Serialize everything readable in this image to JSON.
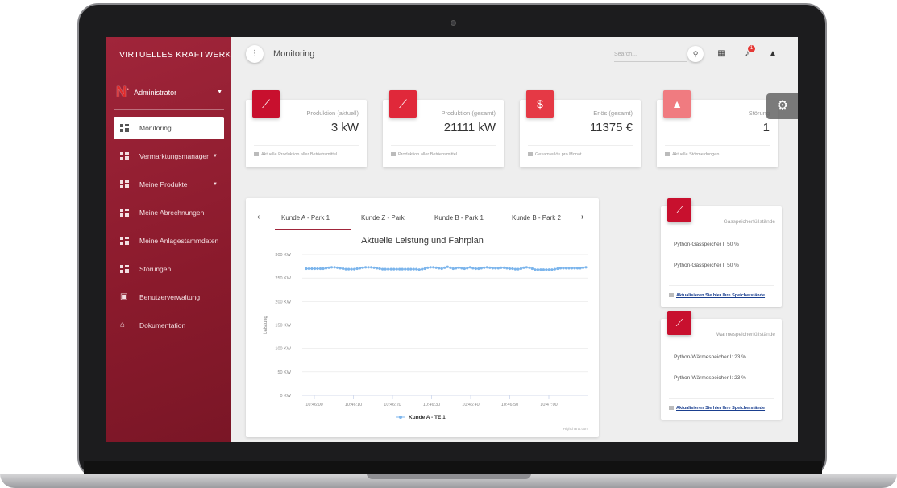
{
  "sidebar": {
    "brand": "VIRTUELLES KRAFTWERK",
    "logo_letter": "N",
    "logo_mark": "•",
    "user": "Administrator",
    "items": [
      {
        "label": "Monitoring",
        "icon": "dashboard-icon",
        "active": true,
        "has_submenu": false
      },
      {
        "label": "Vermarktungsmanager",
        "icon": "dashboard-icon",
        "active": false,
        "has_submenu": true
      },
      {
        "label": "Meine Produkte",
        "icon": "dashboard-icon",
        "active": false,
        "has_submenu": true
      },
      {
        "label": "Meine Abrechnungen",
        "icon": "dashboard-icon",
        "active": false,
        "has_submenu": false
      },
      {
        "label": "Meine Anlagestammdaten",
        "icon": "dashboard-icon",
        "active": false,
        "has_submenu": false
      },
      {
        "label": "Störungen",
        "icon": "dashboard-icon",
        "active": false,
        "has_submenu": false
      },
      {
        "label": "Benutzerverwaltung",
        "icon": "account-box-icon",
        "active": false,
        "has_submenu": false
      },
      {
        "label": "Dokumentation",
        "icon": "school-icon",
        "active": false,
        "has_submenu": false
      }
    ]
  },
  "header": {
    "title": "Monitoring",
    "search_placeholder": "Search...",
    "notification_count": "1"
  },
  "stats": [
    {
      "label": "Produktion (aktuell)",
      "value": "3 kW",
      "footer": "Aktuelle Produktion aller Betriebsmittel",
      "icon": "trending-up-icon",
      "color": "#c8102e"
    },
    {
      "label": "Produktion (gesamt)",
      "value": "21111 kW",
      "footer": "Produktion aller Betriebsmittel",
      "icon": "trending-up-icon",
      "color": "#e0283a"
    },
    {
      "label": "Erlös (gesamt)",
      "value": "11375 €",
      "footer": "Gesamterlös pro Monat",
      "icon": "dollar-icon",
      "color": "#e53945"
    },
    {
      "label": "Störung",
      "value": "1",
      "footer": "Aktuelle Störmeldungen",
      "icon": "warning-icon",
      "color": "#f07b80"
    }
  ],
  "tabs": {
    "items": [
      "Kunde A - Park 1",
      "Kunde Z - Park",
      "Kunde B - Park 1",
      "Kunde B - Park 2"
    ],
    "active_index": 0
  },
  "chart_data": {
    "type": "line",
    "title": "Aktuelle Leistung und Fahrplan",
    "ylabel": "Leistung",
    "xlabel": "",
    "ylim": [
      0,
      300
    ],
    "y_ticks": [
      "0 KW",
      "50 KW",
      "100 KW",
      "150 KW",
      "200 KW",
      "250 KW",
      "300 KW"
    ],
    "x_ticks": [
      "10:46:00",
      "10:46:10",
      "10:46:20",
      "10:46:30",
      "10:46:40",
      "10:46:50",
      "10:47:00"
    ],
    "grid": true,
    "legend": "bottom-center",
    "credits": "Highcharts.com",
    "series": [
      {
        "name": "Kunde A - TE 1",
        "color": "#7cb5ec",
        "values": [
          270,
          270,
          270,
          270,
          270,
          270,
          270,
          271,
          272,
          273,
          273,
          272,
          271,
          270,
          269,
          269,
          269,
          269,
          270,
          271,
          272,
          273,
          273,
          273,
          272,
          271,
          270,
          269,
          269,
          269,
          269,
          269,
          269,
          269,
          269,
          269,
          269,
          269,
          269,
          269,
          268,
          269,
          270,
          272,
          273,
          273,
          272,
          271,
          270,
          272,
          274,
          272,
          270,
          271,
          272,
          271,
          270,
          271,
          273,
          271,
          270,
          270,
          271,
          272,
          273,
          272,
          271,
          271,
          271,
          272,
          272,
          271,
          270,
          270,
          269,
          269,
          270,
          272,
          273,
          272,
          270,
          268,
          268,
          268,
          268,
          268,
          268,
          268,
          269,
          270,
          271,
          271,
          271,
          271,
          271,
          271,
          271,
          271,
          272,
          273
        ]
      }
    ]
  },
  "storage_cards": [
    {
      "title": "Gasspeicherfüllstände",
      "lines": [
        "Python-Gasspeicher I: 50 %",
        "Python-Gasspeicher I: 50 %"
      ],
      "link": "Aktualisieren Sie hier Ihre Speicherstände",
      "icon": "trending-up-icon"
    },
    {
      "title": "Warmespeicherfüllstände",
      "lines": [
        "Python-Wärmespeicher I: 23 %",
        "Python-Wärmespeicher I: 23 %"
      ],
      "link": "Aktualisieren Sie hier Ihre Speicherstände",
      "icon": "trending-up-icon"
    }
  ]
}
